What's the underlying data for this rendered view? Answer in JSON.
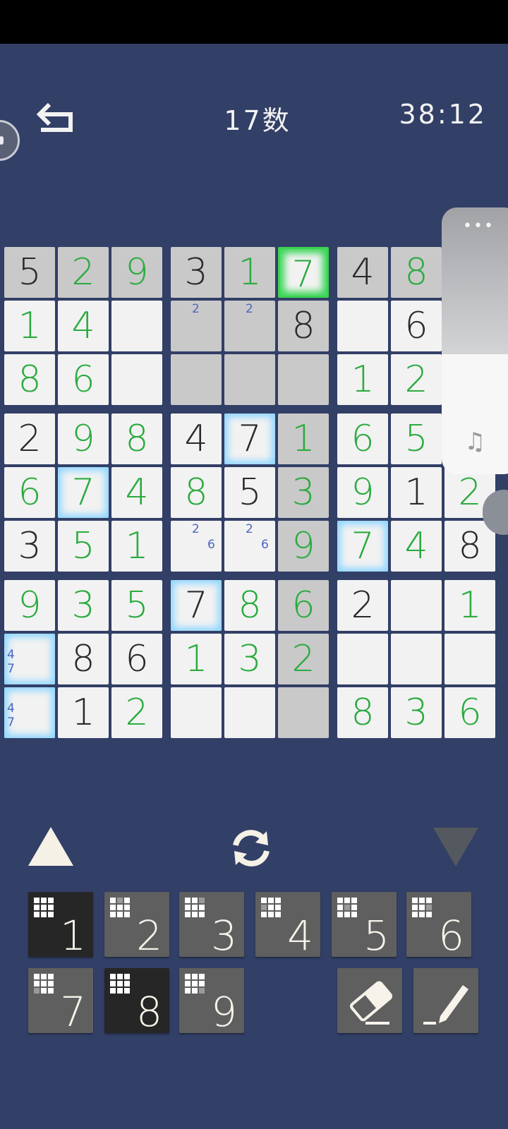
{
  "header": {
    "title": "17数",
    "timer": "38:12"
  },
  "board": {
    "cells": [
      [
        "5",
        "2",
        "9",
        "3",
        "1",
        "7",
        "4",
        "8",
        ""
      ],
      [
        "1",
        "4",
        "",
        "",
        "",
        "8",
        "",
        "6",
        ""
      ],
      [
        "8",
        "6",
        "",
        "",
        "",
        "",
        "1",
        "2",
        ""
      ],
      [
        "2",
        "9",
        "8",
        "4",
        "7",
        "1",
        "6",
        "5",
        ""
      ],
      [
        "6",
        "7",
        "4",
        "8",
        "5",
        "3",
        "9",
        "1",
        "2"
      ],
      [
        "3",
        "5",
        "1",
        "",
        "",
        "9",
        "7",
        "4",
        "8"
      ],
      [
        "9",
        "3",
        "5",
        "7",
        "8",
        "6",
        "2",
        "",
        "1"
      ],
      [
        "",
        "8",
        "6",
        "1",
        "3",
        "2",
        "",
        "",
        ""
      ],
      [
        "",
        "1",
        "2",
        "",
        "",
        "",
        "8",
        "3",
        "6"
      ]
    ],
    "given": [
      [
        1,
        0,
        0,
        1,
        0,
        0,
        1,
        0,
        0
      ],
      [
        0,
        0,
        0,
        0,
        0,
        1,
        0,
        1,
        0
      ],
      [
        0,
        0,
        0,
        0,
        0,
        0,
        0,
        0,
        0
      ],
      [
        1,
        0,
        0,
        1,
        1,
        0,
        0,
        0,
        0
      ],
      [
        0,
        0,
        0,
        0,
        1,
        0,
        0,
        1,
        0
      ],
      [
        1,
        0,
        0,
        0,
        0,
        0,
        0,
        0,
        1
      ],
      [
        0,
        0,
        0,
        1,
        0,
        0,
        1,
        0,
        0
      ],
      [
        0,
        1,
        1,
        0,
        0,
        0,
        0,
        0,
        0
      ],
      [
        0,
        1,
        0,
        0,
        0,
        0,
        0,
        0,
        0
      ]
    ],
    "notes": [
      {
        "r": 1,
        "c": 3,
        "digits": [
          "2"
        ]
      },
      {
        "r": 1,
        "c": 4,
        "digits": [
          "2"
        ]
      },
      {
        "r": 5,
        "c": 3,
        "digits": [
          "2",
          "6"
        ]
      },
      {
        "r": 5,
        "c": 4,
        "digits": [
          "2",
          "6"
        ]
      },
      {
        "r": 7,
        "c": 0,
        "digits": [
          "4",
          "7"
        ]
      },
      {
        "r": 8,
        "c": 0,
        "digits": [
          "4",
          "7"
        ]
      }
    ],
    "selected": {
      "r": 0,
      "c": 5
    }
  },
  "keypad": {
    "numbers": [
      "1",
      "2",
      "3",
      "4",
      "5",
      "6",
      "7",
      "8",
      "9"
    ],
    "active": [
      "1",
      "8"
    ]
  },
  "icons": {
    "back": "undo-arrow-icon",
    "refresh": "refresh-icon",
    "up": "triangle-up-icon",
    "down": "triangle-down-icon",
    "eraser": "eraser-icon",
    "pencil": "pencil-icon",
    "music": "music-note-icon",
    "more": "more-dots-icon"
  },
  "side_panel": {
    "more_label": "•••",
    "music_label": "♫"
  },
  "colors": {
    "background": "#323f66",
    "given": "#2a2a2a",
    "entered": "#2bab3f",
    "note": "#4c66c2",
    "selected": "#3bd34e"
  }
}
